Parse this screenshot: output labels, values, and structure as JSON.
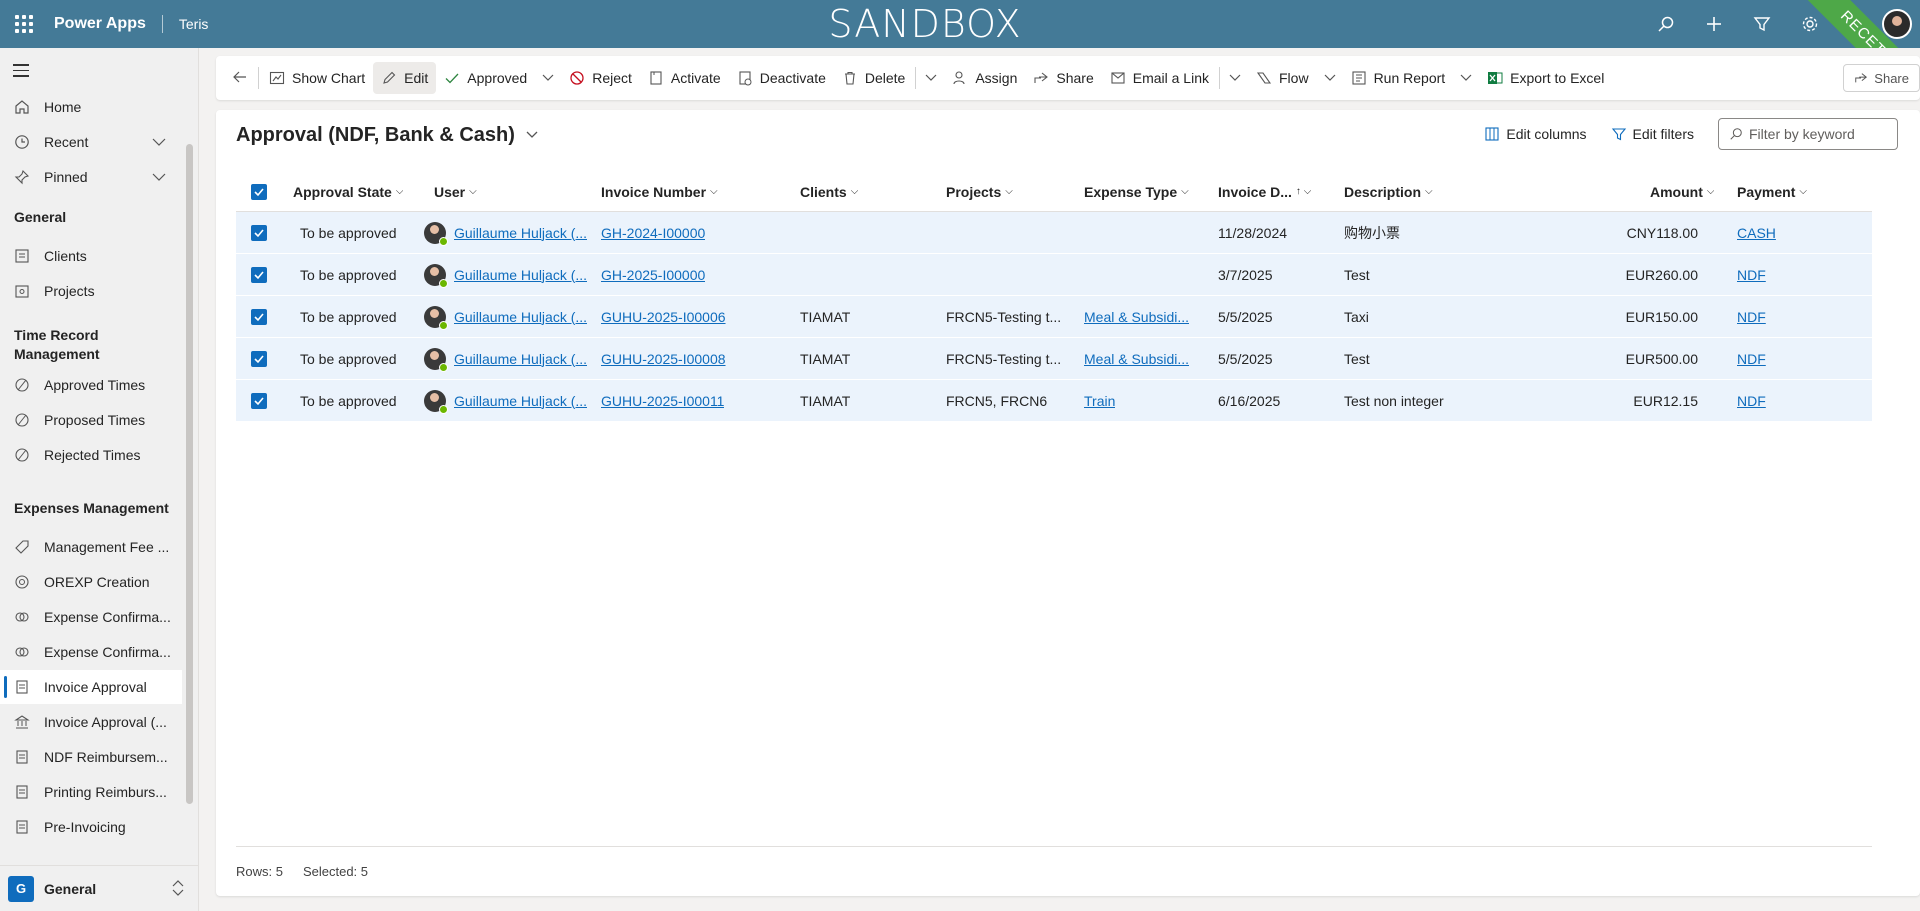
{
  "header": {
    "app_name": "Power Apps",
    "org_name": "Teris",
    "environment_banner": "SANDBOX",
    "ribbon_label": "RECETTE",
    "color": "#447a97"
  },
  "sidebar": {
    "top_items": [
      {
        "label": "Home",
        "icon": "home-icon"
      },
      {
        "label": "Recent",
        "icon": "clock-icon"
      },
      {
        "label": "Pinned",
        "icon": "pin-icon"
      }
    ],
    "sections": [
      {
        "title": "General",
        "items": [
          "Clients",
          "Projects"
        ]
      },
      {
        "title": "Time Record Management",
        "items": [
          "Approved Times",
          "Proposed Times",
          "Rejected Times"
        ]
      },
      {
        "title": "Expenses Management",
        "items": [
          "Management Fee ...",
          "OREXP Creation",
          "Expense Confirma...",
          "Expense Confirma...",
          "Invoice Approval",
          "Invoice Approval (...",
          "NDF Reimbursem...",
          "Printing Reimburs...",
          "Pre-Invoicing"
        ]
      }
    ],
    "selected_item": "Invoice Approval",
    "area": {
      "badge": "G",
      "label": "General"
    }
  },
  "commandbar": {
    "back": "back-arrow-icon",
    "show_chart": "Show Chart",
    "edit": "Edit",
    "approved": "Approved",
    "reject": "Reject",
    "activate": "Activate",
    "deactivate": "Deactivate",
    "delete": "Delete",
    "assign": "Assign",
    "share": "Share",
    "email_link": "Email a Link",
    "flow": "Flow",
    "run_report": "Run Report",
    "export_excel": "Export to Excel",
    "share_right": "Share"
  },
  "view": {
    "title": "Approval (NDF, Bank & Cash)",
    "edit_columns": "Edit columns",
    "edit_filters": "Edit filters",
    "filter_placeholder": "Filter by keyword"
  },
  "grid": {
    "columns": [
      "Approval State",
      "User",
      "Invoice Number",
      "Clients",
      "Projects",
      "Expense Type",
      "Invoice D...",
      "Description",
      "Amount",
      "Payment"
    ],
    "rows": [
      {
        "state": "To be approved",
        "user": "Guillaume Huljack (...",
        "invoice": "GH-2024-I00000",
        "client": "",
        "project": "",
        "expense_type": "",
        "date": "11/28/2024",
        "description": "购物小票",
        "amount": "CNY118.00",
        "payment": "CASH"
      },
      {
        "state": "To be approved",
        "user": "Guillaume Huljack (...",
        "invoice": "GH-2025-I00000",
        "client": "",
        "project": "",
        "expense_type": "",
        "date": "3/7/2025",
        "description": "Test",
        "amount": "EUR260.00",
        "payment": "NDF"
      },
      {
        "state": "To be approved",
        "user": "Guillaume Huljack (...",
        "invoice": "GUHU-2025-I00006",
        "client": "TIAMAT",
        "project": "FRCN5-Testing t...",
        "expense_type": "Meal & Subsidi...",
        "date": "5/5/2025",
        "description": "Taxi",
        "amount": "EUR150.00",
        "payment": "NDF"
      },
      {
        "state": "To be approved",
        "user": "Guillaume Huljack (...",
        "invoice": "GUHU-2025-I00008",
        "client": "TIAMAT",
        "project": "FRCN5-Testing t...",
        "expense_type": "Meal & Subsidi...",
        "date": "5/5/2025",
        "description": "Test",
        "amount": "EUR500.00",
        "payment": "NDF"
      },
      {
        "state": "To be approved",
        "user": "Guillaume Huljack (...",
        "invoice": "GUHU-2025-I00011",
        "client": "TIAMAT",
        "project": "FRCN5,  FRCN6",
        "expense_type": "Train",
        "date": "6/16/2025",
        "description": "Test non integer",
        "amount": "EUR12.15",
        "payment": "NDF"
      }
    ]
  },
  "footer": {
    "rows": "Rows: 5",
    "selected": "Selected: 5"
  }
}
